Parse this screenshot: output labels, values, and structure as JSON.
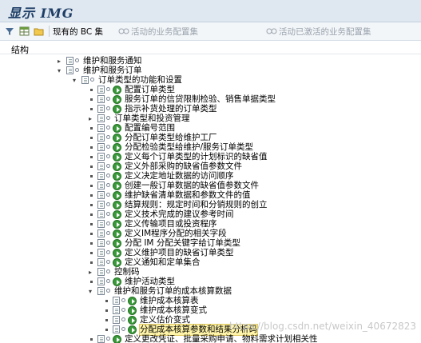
{
  "window": {
    "title": "显示 IMG"
  },
  "toolbar": {
    "existing_bc_sets": "现有的 BC 集",
    "active_bc_sets": "活动的业务配置集",
    "activated_bc_sets": "活动已激活的业务配置集"
  },
  "structure_label": "结构",
  "tree": [
    {
      "label": "维护和服务通知",
      "level": 0,
      "expander": "▸"
    },
    {
      "label": "维护和服务订单",
      "level": 0,
      "expander": "▾"
    },
    {
      "label": "订单类型的功能和设置",
      "level": 1,
      "expander": "▾"
    },
    {
      "label": "配置订单类型",
      "level": 2,
      "expander": ""
    },
    {
      "label": "服务订单的信贷限制检验、销售单据类型",
      "level": 2,
      "expander": ""
    },
    {
      "label": "指示补货处理的订单类型",
      "level": 2,
      "expander": ""
    },
    {
      "label": "订单类型和投资管理",
      "level": 2,
      "expander": "▸"
    },
    {
      "label": "配置编号范围",
      "level": 2,
      "expander": ""
    },
    {
      "label": "分配订单类型给维护工厂",
      "level": 2,
      "expander": ""
    },
    {
      "label": "分配检验类型给维护/服务订单类型",
      "level": 2,
      "expander": ""
    },
    {
      "label": "定义每个订单类型的计划标识的缺省值",
      "level": 2,
      "expander": ""
    },
    {
      "label": "定义外部采购的缺省值参数文件",
      "level": 2,
      "expander": ""
    },
    {
      "label": "定义决定地址数据的访问顺序",
      "level": 2,
      "expander": ""
    },
    {
      "label": "创建一般订单数据的缺省值参数文件",
      "level": 2,
      "expander": ""
    },
    {
      "label": "维护缺省清单数据和参数文件的值",
      "level": 2,
      "expander": ""
    },
    {
      "label": "结算规则：规定时间和分销规则的创立",
      "level": 2,
      "expander": ""
    },
    {
      "label": "定义技术完成的建议参考时间",
      "level": 2,
      "expander": ""
    },
    {
      "label": "定义传输项目或投资程序",
      "level": 2,
      "expander": ""
    },
    {
      "label": "定义IM程序分配的相关字段",
      "level": 2,
      "expander": ""
    },
    {
      "label": "分配 IM 分配关键字给订单类型",
      "level": 2,
      "expander": ""
    },
    {
      "label": "定义维护项目的缺省订单类型",
      "level": 2,
      "expander": ""
    },
    {
      "label": "定义通知和定单集合",
      "level": 2,
      "expander": ""
    },
    {
      "label": "控制码",
      "level": 2,
      "expander": "▸"
    },
    {
      "label": "维护活动类型",
      "level": 2,
      "expander": ""
    },
    {
      "label": "维护和服务订单的成本核算数据",
      "level": 2,
      "expander": "▾"
    },
    {
      "label": "维护成本核算表",
      "level": 3,
      "expander": ""
    },
    {
      "label": "维护成本核算变式",
      "level": 3,
      "expander": ""
    },
    {
      "label": "定义估价变式",
      "level": 3,
      "expander": ""
    },
    {
      "label": "分配成本核算参数和结果分析码",
      "level": 3,
      "expander": "",
      "selected": true
    },
    {
      "label": "定义更改凭证、批量采购申请、物料需求计划相关性",
      "level": 2,
      "expander": ""
    }
  ],
  "watermark": "https://blog.csdn.net/weixin_40672823"
}
